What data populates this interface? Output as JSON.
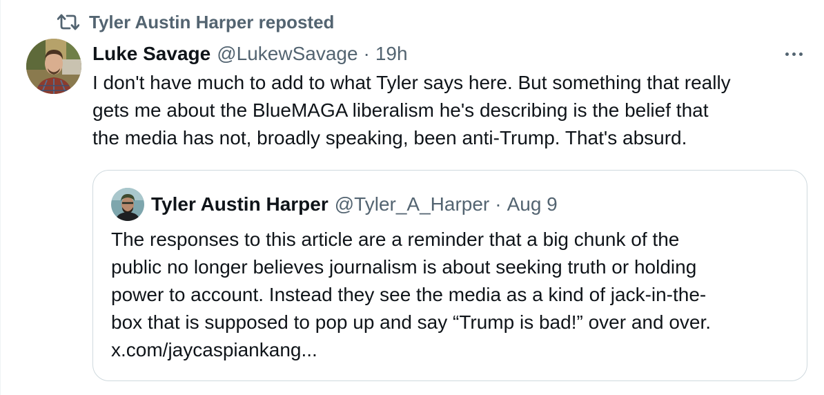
{
  "repost": {
    "label": "Tyler Austin Harper reposted",
    "icon": "repost-icon"
  },
  "tweet": {
    "author_name": "Luke Savage",
    "handle": "@LukewSavage",
    "separator": "·",
    "time": "19h",
    "more_icon": "more-icon",
    "text_lines": [
      "I don't have much to add to what Tyler says here. But something that really",
      "gets me about the BlueMAGA liberalism he's describing is the belief that",
      "the media has not, broadly speaking, been anti-Trump. That's absurd."
    ]
  },
  "quote": {
    "author_name": "Tyler Austin Harper",
    "handle": "@Tyler_A_Harper",
    "separator": "·",
    "time": "Aug 9",
    "text_lines": [
      "The responses to this article are a reminder that a big chunk of the",
      "public no longer believes journalism is about seeking truth or holding",
      "power to account. Instead they see the media as a kind of jack-in-the-",
      "box that is supposed to pop up and say “Trump is bad!” over and over.",
      "x.com/jaycaspiankang..."
    ]
  },
  "colors": {
    "text": "#0f1419",
    "secondary": "#536471",
    "border": "#cfd9de"
  }
}
